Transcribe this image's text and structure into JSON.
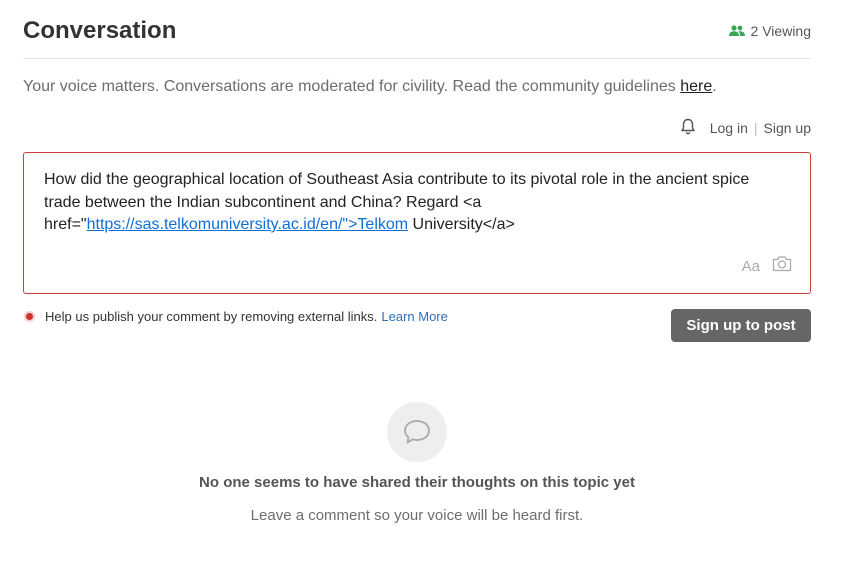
{
  "header": {
    "title": "Conversation",
    "viewing_label": "2 Viewing",
    "viewing_icon": "users-icon",
    "viewing_color": "#3aa757"
  },
  "intro": {
    "text": "Your voice matters. Conversations are moderated for civility. Read the community guidelines ",
    "link_label": "here",
    "suffix": "."
  },
  "auth": {
    "notification_icon": "bell-icon",
    "login_label": "Log in",
    "separator": "|",
    "signup_label": "Sign up"
  },
  "editor": {
    "text_before": "How did the geographical location of Southeast Asia contribute to its pivotal role in the ancient spice trade between the Indian subcontinent and China? Regard <a href=\"",
    "link_text": "https://sas.telkomuniversity.ac.id/en/\">Telkom",
    "text_after": " University</a>",
    "format_label": "Aa",
    "format_icon": "text-format-icon",
    "camera_icon": "camera-icon",
    "border_color": "#cf3c3c"
  },
  "error": {
    "message": "Help us publish your comment by removing external links.",
    "link_label": "Learn More",
    "color": "#d0312d"
  },
  "post_button": {
    "label": "Sign up to post"
  },
  "empty_state": {
    "icon": "speech-bubble-icon",
    "title": "No one seems to have shared their thoughts on this topic yet",
    "subtitle": "Leave a comment so your voice will be heard first."
  }
}
